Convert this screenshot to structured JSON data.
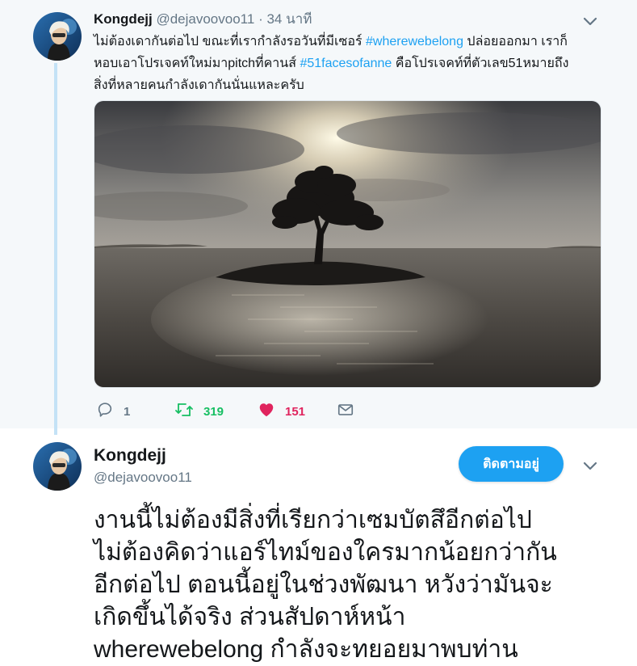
{
  "parent_tweet": {
    "author_name": "Kongdejj",
    "handle": "@dejavoovoo11",
    "separator": "·",
    "time": "34 นาที",
    "text_lines": [
      {
        "before": "ไม่ต้องเดากันต่อไป ขณะที่เรากำลังรอวันที่มีเซอร์ ",
        "hashtag": "#wherewebelong",
        "after": " ปล่อยออกมา เราก็"
      },
      {
        "before": "หอบเอาโปรเจคท์ใหม่มาpitchที่คานส์  ",
        "hashtag": "#51facesofanne",
        "after": " คือโปรเจคท์ที่ตัวเลข51หมายถึง"
      },
      {
        "before": "สิ่งที่หลายคนกำลังเดากันนั่นแหละครับ",
        "hashtag": "",
        "after": ""
      }
    ],
    "media": {
      "description_icon": "photo-tree-on-island-sunset"
    },
    "actions": {
      "replies": "1",
      "retweets": "319",
      "likes": "151"
    }
  },
  "main_tweet": {
    "author_name": "Kongdejj",
    "handle": "@dejavoovoo11",
    "follow_button_label": "ติดตามอยู่",
    "text_lines": [
      "งานนี้ไม่ต้องมีสิ่งที่เรียกว่าเซมบัตสึอีกต่อไป",
      "ไม่ต้องคิดว่าแอร์ไทม์ของใครมากน้อยกว่ากัน",
      "อีกต่อไป ตอนนี้อยู่ในช่วงพัฒนา หวังว่ามันจะ",
      "เกิดขึ้นได้จริง ส่วนสัปดาห์หน้า",
      "wherewebelong กำลังจะทยอยมาพบท่าน"
    ]
  },
  "colors": {
    "accent": "#1da1f2",
    "retweet": "#17bf63",
    "like": "#e0245e",
    "muted": "#657786",
    "thread_line": "#c4e2f6"
  },
  "icons": [
    "chevron-down-icon",
    "reply-icon",
    "retweet-icon",
    "heart-icon",
    "envelope-icon"
  ]
}
